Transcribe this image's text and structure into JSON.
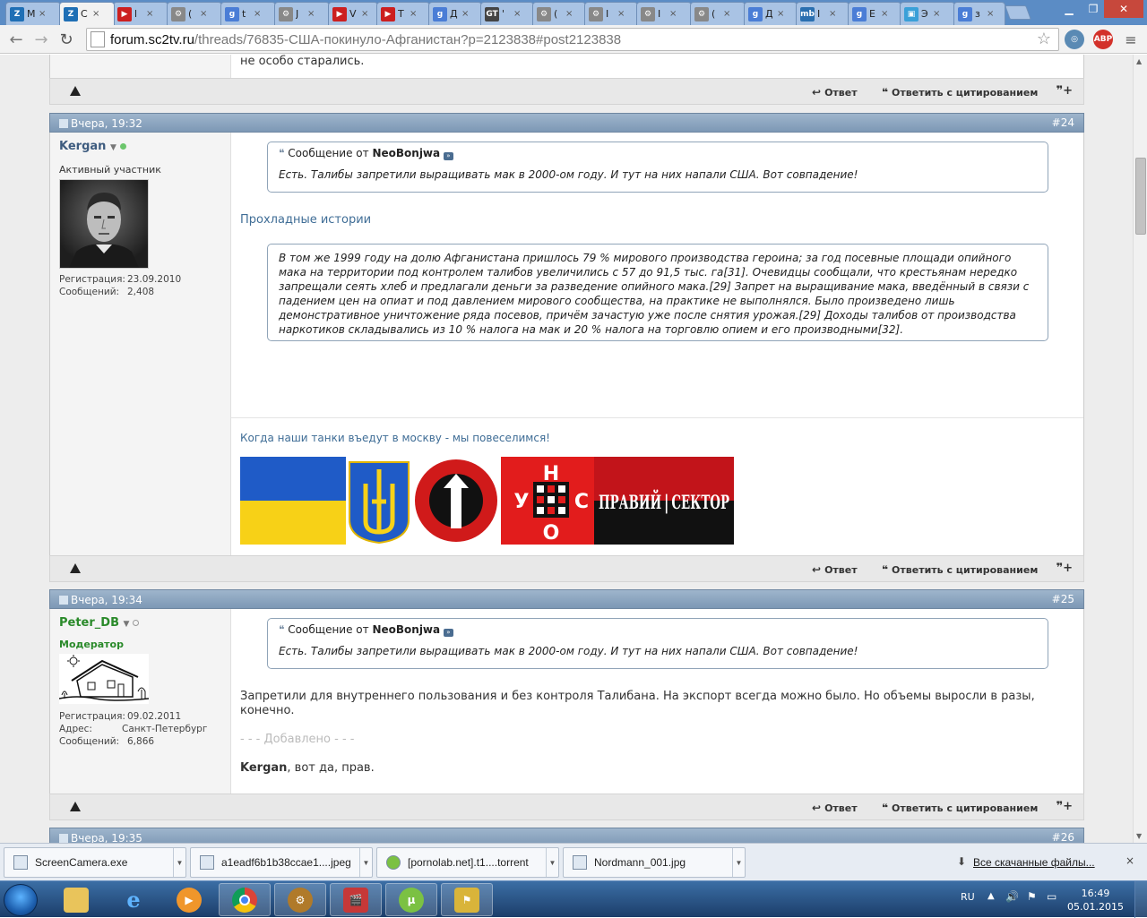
{
  "browser": {
    "tabs": [
      {
        "label": "М",
        "color": "#1f6fb5",
        "glyph": "Z"
      },
      {
        "label": "С",
        "color": "#1f6fb5",
        "glyph": "Z",
        "active": true
      },
      {
        "label": "l",
        "color": "#cc1f1f",
        "glyph": "▶"
      },
      {
        "label": "(",
        "color": "#888888",
        "glyph": "⚙"
      },
      {
        "label": "t",
        "color": "#4a7dd6",
        "glyph": "g"
      },
      {
        "label": "J",
        "color": "#888888",
        "glyph": "⚙"
      },
      {
        "label": "V",
        "color": "#cc1f1f",
        "glyph": "▶"
      },
      {
        "label": "T",
        "color": "#cc1f1f",
        "glyph": "▶"
      },
      {
        "label": "Д",
        "color": "#4a7dd6",
        "glyph": "g"
      },
      {
        "label": "'",
        "color": "#444444",
        "glyph": "GT"
      },
      {
        "label": "(",
        "color": "#888888",
        "glyph": "⚙"
      },
      {
        "label": "I",
        "color": "#888888",
        "glyph": "⚙"
      },
      {
        "label": "I",
        "color": "#888888",
        "glyph": "⚙"
      },
      {
        "label": "(",
        "color": "#888888",
        "glyph": "⚙"
      },
      {
        "label": "Д",
        "color": "#4a7dd6",
        "glyph": "g"
      },
      {
        "label": "I",
        "color": "#2a6fb0",
        "glyph": "mb"
      },
      {
        "label": "E",
        "color": "#4a7dd6",
        "glyph": "g"
      },
      {
        "label": "Э",
        "color": "#3aa0d8",
        "glyph": "▣"
      },
      {
        "label": "з",
        "color": "#4a7dd6",
        "glyph": "g"
      }
    ],
    "url_host": "forum.sc2tv.ru",
    "url_rest": "/threads/76835-США-покинуло-Афганистан?p=2123838#post2123838",
    "ext_abp": "ABP"
  },
  "prev_post_tail": "не особо старались.",
  "foot": {
    "reply": "Ответ",
    "quote_reply": "Ответить с цитированием",
    "multiquote": "+"
  },
  "post24": {
    "date": "Вчера, 19:32",
    "num": "#24",
    "user": "Kergan",
    "title": "Активный участник",
    "reg_label": "Регистрация:",
    "reg": "23.09.2010",
    "msgs_label": "Сообщений:",
    "msgs": "2,408",
    "quote_prefix": "Сообщение от",
    "quote_author": "NeoBonjwa",
    "quote_text": "Есть. Талибы запретили выращивать мак в 2000-ом году. И тут на них напали США. Вот совпадение!",
    "link_text": "Прохладные истории",
    "quote2_text": "В том же 1999 году на долю Афганистана пришлось 79 % мирового производства героина; за год посевные площади опийного мака на территории под контролем талибов увеличились с 57 до 91,5 тыс. га[31]. Очевидцы сообщали, что крестьянам нередко запрещали сеять хлеб и предлагали деньги за разведение опийного мака.[29] Запрет на выращивание мака, введённый в связи с падением цен на опиат и под давлением мирового сообщества, на практике не выполнялся. Было произведено лишь демонстративное уничтожение ряда посевов, причём зачастую уже после снятия урожая.[29] Доходы талибов от производства наркотиков складывались из 10 % налога на мак и 20 % налога на торговлю опием и его производными[32].",
    "signature": "Когда наши танки въедут в москву - мы повеселимся!",
    "sig_logo_text": "ПРАВИЙ СЕКТОР"
  },
  "post25": {
    "date": "Вчера, 19:34",
    "num": "#25",
    "user": "Peter_DB",
    "title": "Модератор",
    "reg_label": "Регистрация:",
    "reg": "09.02.2011",
    "addr_label": "Адрес:",
    "addr": "Санкт-Петербург",
    "msgs_label": "Сообщений:",
    "msgs": "6,866",
    "quote_prefix": "Сообщение от",
    "quote_author": "NeoBonjwa",
    "quote_text": "Есть. Талибы запретили выращивать мак в 2000-ом году. И тут на них напали США. Вот совпадение!",
    "text": "Запретили для внутреннего пользования и без контроля Талибана. На экспорт всегда можно было. Но объемы выросли в разы, конечно.",
    "added": "- - - Добавлено - - -",
    "mention": "Kergan",
    "mention_rest": ", вот да, прав."
  },
  "post26": {
    "date": "Вчера, 19:35",
    "num": "#26"
  },
  "downloads": {
    "items": [
      "ScreenCamera.exe",
      "a1eadf6b1b38ccae1....jpeg",
      "[pornolab.net].t1....torrent",
      "Nordmann_001.jpg"
    ],
    "all_label": "Все скачанные файлы...",
    "close": "×"
  },
  "taskbar": {
    "lang": "RU",
    "time": "16:49",
    "date": "05.01.2015"
  },
  "colors": {
    "header_bar": "#7d98b5",
    "username": "#3e5c7f",
    "moderator": "#2a8a2a",
    "link": "#3f6d96"
  }
}
